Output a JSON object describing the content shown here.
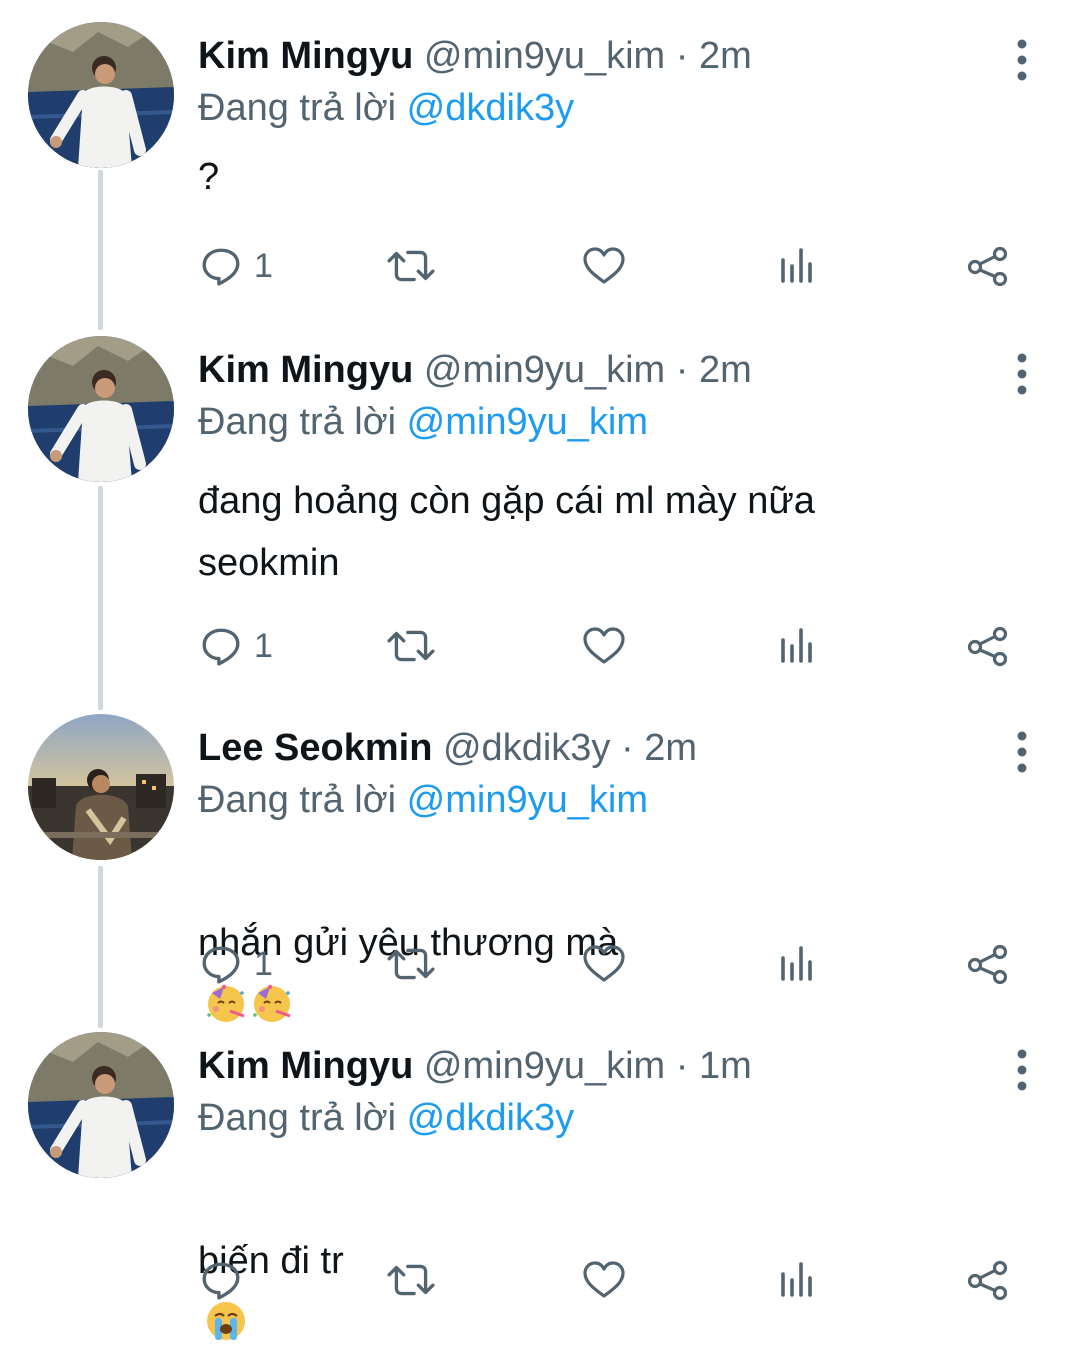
{
  "colors": {
    "link": "#1d9bf0",
    "secondary_text": "#536471",
    "thread_line": "#cfd9de"
  },
  "tweets": [
    {
      "name": "Kim Mingyu",
      "handle": "@min9yu_kim",
      "dot": "·",
      "time": "2m",
      "reply_prefix": "Đang trả lời",
      "reply_to": "@dkdik3y",
      "text": "?",
      "reply_count": "1",
      "avatar": "kim-mingyu-avatar"
    },
    {
      "name": "Kim Mingyu",
      "handle": "@min9yu_kim",
      "dot": "·",
      "time": "2m",
      "reply_prefix": "Đang trả lời",
      "reply_to": "@min9yu_kim",
      "text": "đang hoảng còn gặp cái ml mày nữa\nseokmin",
      "reply_count": "1",
      "avatar": "kim-mingyu-avatar"
    },
    {
      "name": "Lee Seokmin",
      "handle": "@dkdik3y",
      "dot": "·",
      "time": "2m",
      "reply_prefix": "Đang trả lời",
      "reply_to": "@min9yu_kim",
      "text": "nhắn gửi yêu thương mà",
      "emoji": [
        "partying-face-emoji",
        "partying-face-emoji"
      ],
      "reply_count": "1",
      "avatar": "lee-seokmin-avatar"
    },
    {
      "name": "Kim Mingyu",
      "handle": "@min9yu_kim",
      "dot": "·",
      "time": "1m",
      "reply_prefix": "Đang trả lời",
      "reply_to": "@dkdik3y",
      "text": "biến đi tr",
      "emoji": [
        "loudly-crying-face-emoji"
      ],
      "reply_count": "",
      "avatar": "kim-mingyu-avatar"
    }
  ],
  "icons": {
    "reply": "reply-bubble-icon",
    "retweet": "retweet-icon",
    "like": "heart-icon",
    "views": "views-bar-chart-icon",
    "share": "share-icon",
    "more": "more-vertical-icon"
  }
}
